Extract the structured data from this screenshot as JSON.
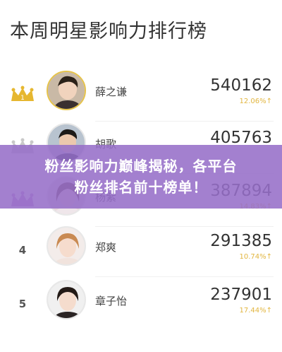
{
  "page": {
    "title": "本周明星影响力排行榜"
  },
  "ranking": [
    {
      "rank": "",
      "crown": "gold",
      "name": "薛之谦",
      "score": "540162",
      "percent": "12.06%↑"
    },
    {
      "rank": "",
      "crown": "silver",
      "name": "胡歌",
      "score": "405763",
      "percent": ""
    },
    {
      "rank": "",
      "crown": "bronze",
      "name": "杨紫",
      "score": "387894",
      "percent": "14.83%↑"
    },
    {
      "rank": "4",
      "crown": "",
      "name": "郑爽",
      "score": "291385",
      "percent": "10.74%↑"
    },
    {
      "rank": "5",
      "crown": "",
      "name": "章子怡",
      "score": "237901",
      "percent": "17.44%↑"
    }
  ],
  "banner": {
    "line1": "粉丝影响力巅峰揭秘，各平台",
    "line2": "粉丝排名前十榜单！"
  },
  "colors": {
    "gold": "#e6b730",
    "silver": "#c9c9c9",
    "bronze": "#c48bd0",
    "percent": "#e2b640",
    "banner": "#966ec8"
  }
}
